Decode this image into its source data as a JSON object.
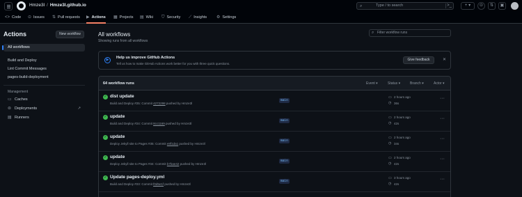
{
  "header": {
    "owner": "Hmze3l",
    "repo": "Hmze3l.github.io",
    "search_placeholder": "Type / to search",
    "search_kbd": "/",
    "search_cmd": ">_",
    "plus_label": "+ ▾",
    "icons": [
      "hamburger-icon",
      "github-logo",
      "search-icon",
      "command-palette-icon",
      "plus-icon",
      "issues-icon",
      "pull-requests-icon",
      "inbox-icon",
      "avatar"
    ]
  },
  "tabs": [
    {
      "label": "Code",
      "icon": "<>"
    },
    {
      "label": "Issues",
      "icon": "⊙"
    },
    {
      "label": "Pull requests",
      "icon": "⇅"
    },
    {
      "label": "Actions",
      "icon": "▶",
      "active": true
    },
    {
      "label": "Projects",
      "icon": "▦"
    },
    {
      "label": "Wiki",
      "icon": "▤"
    },
    {
      "label": "Security",
      "icon": "⛉"
    },
    {
      "label": "Insights",
      "icon": "⟋"
    },
    {
      "label": "Settings",
      "icon": "⚙"
    }
  ],
  "sidebar": {
    "title": "Actions",
    "new_workflow": "New workflow",
    "all_workflows": "All workflows",
    "workflows": [
      "Build and Deploy",
      "Lint Commit Messages",
      "pages-build-deployment"
    ],
    "management_heading": "Management",
    "management": [
      {
        "label": "Caches",
        "icon": "▭"
      },
      {
        "label": "Deployments",
        "icon": "⊚",
        "ext": "↗"
      },
      {
        "label": "Runners",
        "icon": "▤"
      }
    ]
  },
  "main": {
    "title": "All workflows",
    "subtitle": "Showing runs from all workflows",
    "filter_placeholder": "Filter workflow runs"
  },
  "banner": {
    "title": "Help us improve GitHub Actions",
    "text": "Tell us how to make GitHub Actions work better for you with three quick questions.",
    "button": "Give feedback",
    "close": "✕"
  },
  "runs": {
    "count": "64 workflow runs",
    "filters": [
      "Event ▾",
      "Status ▾",
      "Branch ▾",
      "Actor ▾"
    ],
    "items": [
      {
        "title": "dist update",
        "workflow": "Build and Deploy",
        "num": "#25:",
        "sha": "4272298",
        "actor": "Hmze3l",
        "branch": "main",
        "ago": "2 hours ago",
        "duration": "36s"
      },
      {
        "title": "update",
        "workflow": "Build and Deploy",
        "num": "#24:",
        "sha": "8cc1169",
        "actor": "Hmze3l",
        "branch": "main",
        "ago": "2 hours ago",
        "duration": "42s"
      },
      {
        "title": "update",
        "workflow": "Deploy Jekyll site to Pages",
        "num": "#35:",
        "sha": "e8f1da1",
        "actor": "Hmze3l",
        "branch": "main",
        "ago": "2 hours ago",
        "duration": "34s"
      },
      {
        "title": "update",
        "workflow": "Deploy Jekyll site to Pages",
        "num": "#34:",
        "sha": "b7bae42",
        "actor": "Hmze3l",
        "branch": "main",
        "ago": "2 hours ago",
        "duration": "42s"
      },
      {
        "title": "Update pages-deploy.yml",
        "workflow": "Build and Deploy",
        "num": "#23:",
        "sha": "f0d5e1f",
        "actor": "Hmze3l",
        "branch": "main",
        "ago": "3 hours ago",
        "duration": "42s"
      }
    ],
    "text": {
      "commit": "Commit",
      "pushed_by": "pushed by"
    }
  }
}
